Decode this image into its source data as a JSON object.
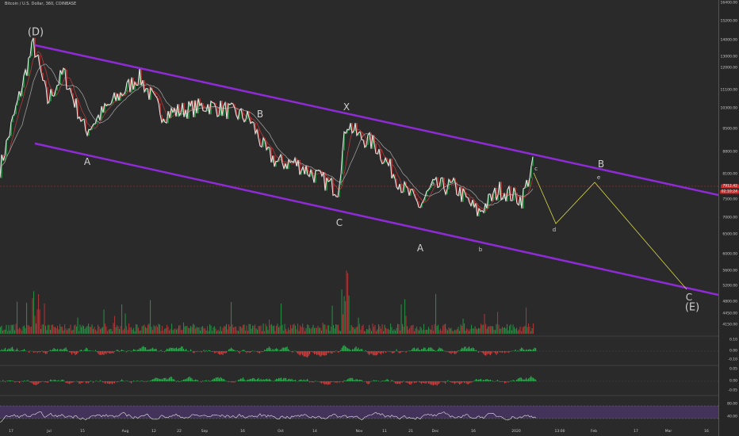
{
  "chart_title": "Bitcoin / U.S. Dollar, 360, COINBASE",
  "colors": {
    "background": "#2a2a2a",
    "channel": "#8e2bd6",
    "projection": "#d8d84a",
    "price_line": "#cc2b2b",
    "up": "#27a84a",
    "down": "#d23a3a",
    "rsi_band": "#4a3566",
    "rsi_line": "#e6e6e6"
  },
  "price_axis": {
    "labels": [
      "16400.00",
      "15200.00",
      "14000.00",
      "13000.00",
      "12000.00",
      "11100.00",
      "10300.00",
      "9500.00",
      "8800.00",
      "8100.00",
      "7500.00",
      "7000.00",
      "6500.00",
      "6000.00",
      "5600.00",
      "5200.00",
      "4800.00",
      "4450.00",
      "4150.00"
    ],
    "current_price_tag": "7912.42",
    "current_time_tag": "02:10:24"
  },
  "osc1_axis": {
    "labels": [
      "0.10",
      "0.00",
      "-0.10"
    ]
  },
  "osc2_axis": {
    "labels": [
      "0.05",
      "0.00",
      "-0.05"
    ]
  },
  "rsi_axis": {
    "labels": [
      "80.00",
      "40.00"
    ]
  },
  "time_axis": {
    "labels": [
      "17",
      "Jul",
      "15",
      "Aug",
      "12",
      "22",
      "Sep",
      "16",
      "Oct",
      "14",
      "Nov",
      "11",
      "21",
      "Dec",
      "16",
      "2020",
      "13:00",
      "Feb",
      "17",
      "Mar",
      "16"
    ]
  },
  "wave_labels": {
    "D_major": "(D)",
    "A1": "A",
    "B1": "B",
    "X": "X",
    "C1": "C",
    "A2": "A",
    "a": "a",
    "b": "b",
    "c": "c",
    "d": "d",
    "e": "e",
    "B2": "B",
    "C2": "C",
    "E_major": "(E)"
  },
  "chart_data": {
    "type": "line",
    "title": "Bitcoin / U.S. Dollar, 360, COINBASE",
    "series": [
      {
        "x": [
          "Jun 14",
          "Jun 26",
          "Jul 2",
          "Jul 10",
          "Jul 17",
          "Jul 26",
          "Aug 6",
          "Aug 15",
          "Aug 22",
          "Sep 2",
          "Sep 8",
          "Sep 20",
          "Sep 24",
          "Oct 2",
          "Oct 8",
          "Oct 22",
          "Oct 26",
          "Nov 1",
          "Nov 8",
          "Nov 18",
          "Nov 25",
          "Dec 4",
          "Dec 10",
          "Dec 17",
          "Dec 24",
          "Jan 2",
          "Jan 8"
        ],
        "values": [
          8100,
          13800,
          10800,
          12200,
          9500,
          10500,
          12000,
          10200,
          10400,
          10600,
          10400,
          10000,
          8700,
          8300,
          8300,
          7400,
          9900,
          9300,
          9000,
          7400,
          6900,
          7500,
          7500,
          6700,
          7400,
          7100,
          8300
        ]
      }
    ],
    "ylim": [
      4150,
      16400
    ],
    "log_scale": true,
    "grid": false
  }
}
